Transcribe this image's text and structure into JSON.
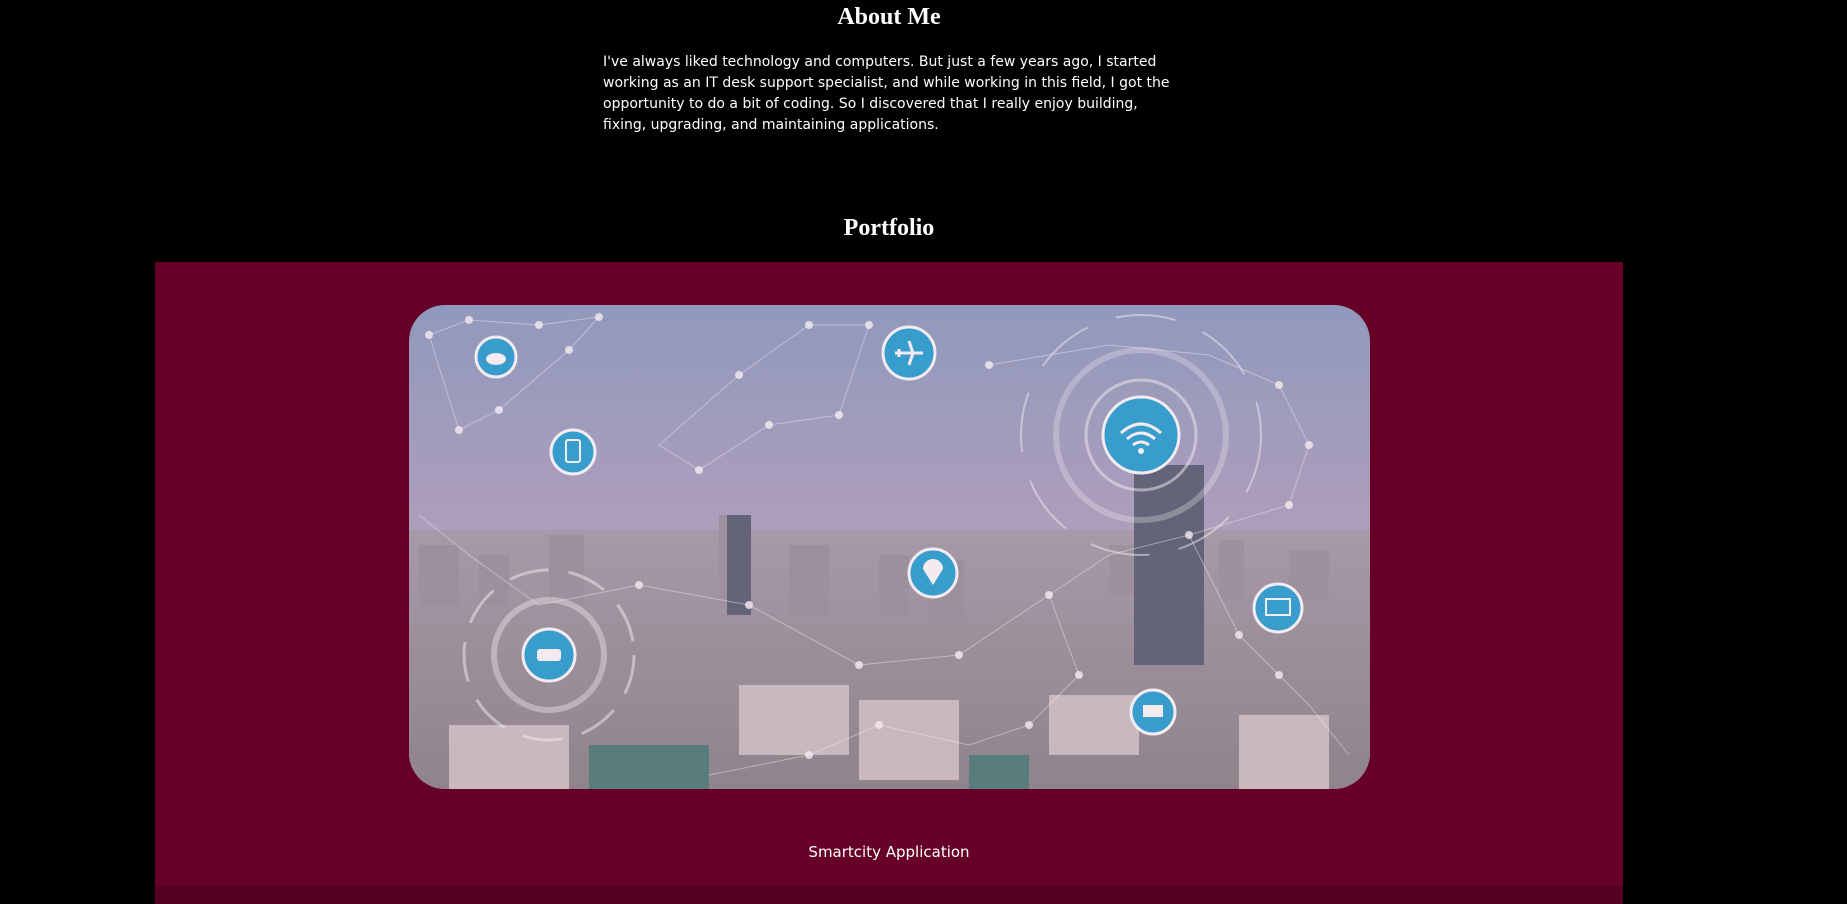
{
  "about": {
    "heading": "About Me",
    "paragraph": "I've always liked technology and computers. But just a few years ago, I started working as an IT desk support specialist, and while working in this field, I got the opportunity to do a bit of coding. So I discovered that I really enjoy building, fixing, upgrading, and maintaining applications."
  },
  "portfolio": {
    "heading": "Portfolio",
    "items": [
      {
        "caption": "Smartcity Application",
        "image": "smart-city-skyline"
      }
    ]
  },
  "colors": {
    "page_background": "#000000",
    "portfolio_background": "#660026",
    "text": "#ffffff",
    "icon_badge": "#2aa7d6"
  }
}
